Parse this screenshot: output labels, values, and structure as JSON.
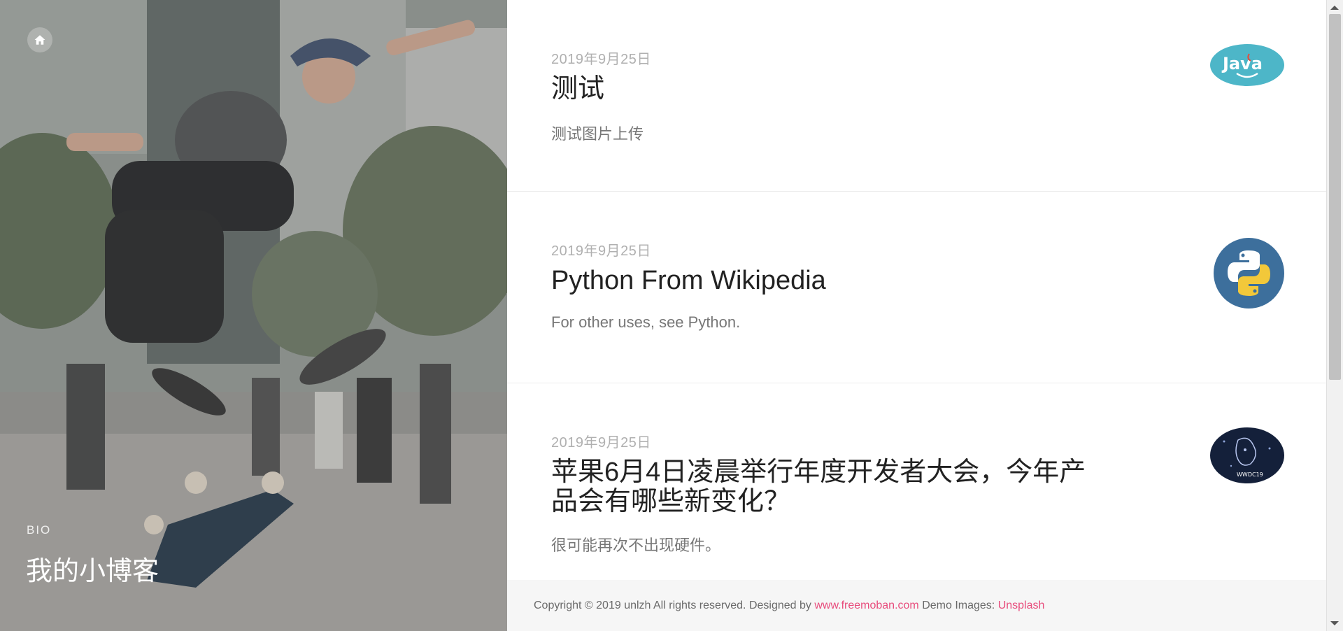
{
  "hero": {
    "bio_label": "BIO",
    "title": "我的小博客",
    "home_icon": "home-icon"
  },
  "posts": [
    {
      "date": "2019年9月25日",
      "title": "测试",
      "excerpt": "测试图片上传",
      "thumb": "java-logo",
      "thumb_text": "Java"
    },
    {
      "date": "2019年9月25日",
      "title": "Python From Wikipedia",
      "excerpt": "For other uses, see Python.",
      "thumb": "python-logo"
    },
    {
      "date": "2019年9月25日",
      "title": "苹果6月4日凌晨举行年度开发者大会，今年产品会有哪些新变化？",
      "excerpt": "很可能再次不出现硬件。",
      "thumb": "wwdc-logo",
      "thumb_text": "WWDC19"
    }
  ],
  "footer": {
    "text_prefix": "Copyright © 2019 unlzh All rights reserved. Designed by",
    "link1": "www.freemoban.com",
    "text_mid": "Demo Images:",
    "link2": "Unsplash"
  },
  "colors": {
    "accent": "#e84c7c",
    "java_bg": "#4db6c8",
    "python_bg": "#3d6f9c",
    "wwdc_bg": "#14203a"
  }
}
